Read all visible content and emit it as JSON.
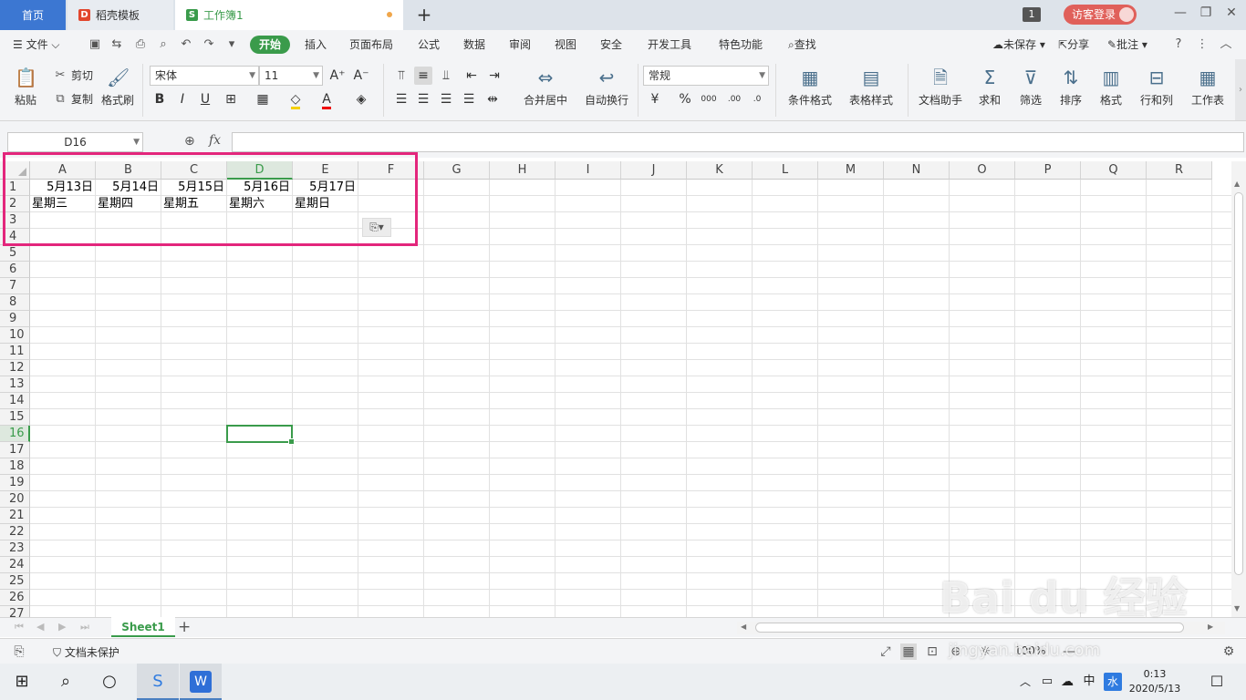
{
  "tabs": {
    "home": "首页",
    "docer": "稻壳模板",
    "workbook": "工作簿1",
    "docer_icon": "D",
    "workbook_icon": "S"
  },
  "titlebar": {
    "window_count": "1",
    "login": "访客登录"
  },
  "menu": {
    "file": "文件",
    "items": [
      "开始",
      "插入",
      "页面布局",
      "公式",
      "数据",
      "审阅",
      "视图",
      "安全",
      "开发工具",
      "特色功能"
    ],
    "search": "查找",
    "unsaved": "未保存",
    "share": "分享",
    "comment": "批注"
  },
  "ribbon": {
    "paste": "粘贴",
    "cut": "剪切",
    "copy": "复制",
    "format_painter": "格式刷",
    "font_name": "宋体",
    "font_size": "11",
    "merge_center": "合并居中",
    "wrap_text": "自动换行",
    "number_format": "常规",
    "conditional_format": "条件格式",
    "table_style": "表格样式",
    "doc_assistant": "文档助手",
    "sum": "求和",
    "filter": "筛选",
    "sort": "排序",
    "format": "格式",
    "row_col": "行和列",
    "worksheet": "工作表"
  },
  "formula": {
    "name_box": "D16",
    "fx": "fx",
    "value": ""
  },
  "grid": {
    "columns": [
      "A",
      "B",
      "C",
      "D",
      "E",
      "F",
      "G",
      "H",
      "I",
      "J",
      "K",
      "L",
      "M",
      "N",
      "O",
      "P",
      "Q",
      "R"
    ],
    "active_column": "D",
    "active_row": "16",
    "rows": [
      "1",
      "2",
      "3",
      "4",
      "5",
      "6",
      "7",
      "8",
      "9",
      "10",
      "11",
      "12",
      "13",
      "14",
      "15",
      "16",
      "17",
      "18",
      "19",
      "20",
      "21",
      "22",
      "23",
      "24",
      "25",
      "26",
      "27"
    ],
    "row1": [
      "5月13日",
      "5月14日",
      "5月15日",
      "5月16日",
      "5月17日"
    ],
    "row2": [
      "星期三",
      "星期四",
      "星期五",
      "星期六",
      "星期日"
    ]
  },
  "sheets": {
    "active": "Sheet1"
  },
  "status": {
    "protect": "文档未保护",
    "zoom": "100%"
  },
  "taskbar": {
    "time": "0:13",
    "date": "2020/5/13",
    "ime": "中",
    "ime2": "水"
  },
  "watermark": {
    "main": "Bai du 经验",
    "sub": "jingyan.baidu.com"
  },
  "colors": {
    "accent": "#3a9b4b",
    "highlight": "#e3267c",
    "home_tab": "#3c77d2"
  }
}
